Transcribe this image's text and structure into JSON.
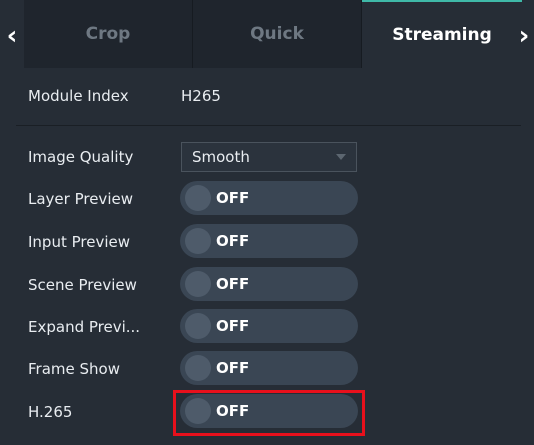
{
  "nav": {
    "prev_icon": "chevron-left-icon",
    "next_icon": "chevron-right-icon",
    "prev_glyph": "‹",
    "next_glyph": "›"
  },
  "tabs": [
    {
      "label": "Crop",
      "active": false
    },
    {
      "label": "Quick",
      "active": false
    },
    {
      "label": "Streaming",
      "active": true
    }
  ],
  "module": {
    "label": "Module Index",
    "value": "H265"
  },
  "image_quality": {
    "label": "Image Quality",
    "value": "Smooth"
  },
  "toggles": [
    {
      "label": "Layer Preview",
      "state": "OFF"
    },
    {
      "label": "Input Preview",
      "state": "OFF"
    },
    {
      "label": "Scene Preview",
      "state": "OFF"
    },
    {
      "label": "Expand Previ...",
      "state": "OFF"
    },
    {
      "label": "Frame Show",
      "state": "OFF"
    },
    {
      "label": "H.265",
      "state": "OFF",
      "highlighted": true
    }
  ],
  "colors": {
    "background": "#262d36",
    "accent": "#3fb9a8",
    "highlight_border": "#e8101c",
    "toggle_track": "#3a4654"
  }
}
